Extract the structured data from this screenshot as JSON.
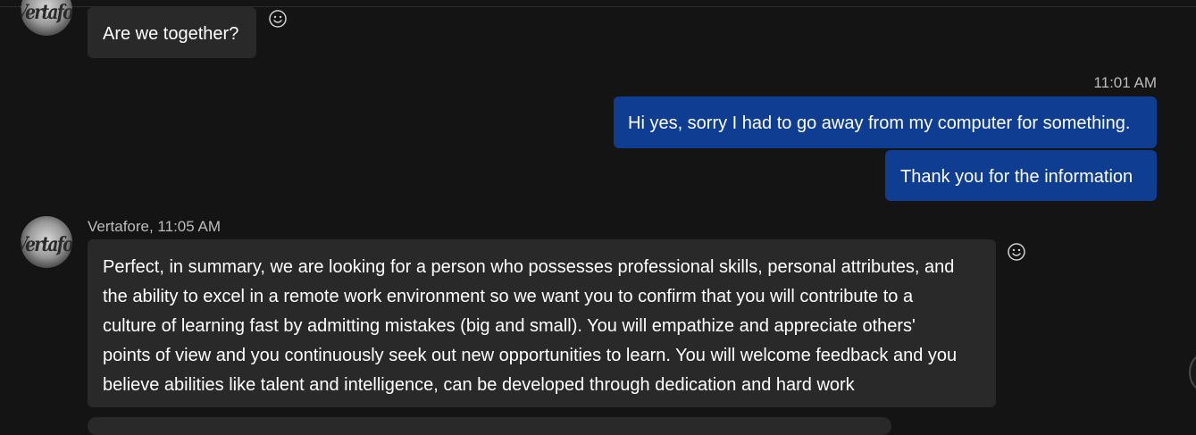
{
  "messages": [
    {
      "direction": "incoming",
      "avatar_logo": "Vertafor",
      "text": "Are we together?"
    },
    {
      "direction": "outgoing",
      "timestamp": "11:01 AM",
      "texts": [
        "Hi yes, sorry I had to go away from my computer for something.",
        "Thank you for the information"
      ]
    },
    {
      "direction": "incoming",
      "sender_meta": "Vertafore, 11:05 AM",
      "avatar_logo": "Vertafor",
      "lines": [
        "Perfect, in summary, we are looking for a person who possesses professional skills, personal attributes, and",
        "the ability to excel in a remote work environment so we want you to confirm that you will contribute to a",
        "culture of learning fast by admitting mistakes (big and small). You will empathize and appreciate others'",
        "points of view and you continuously seek out new opportunities to learn. You will welcome feedback and you",
        "believe abilities like talent and intelligence, can be developed through dedication and hard work"
      ]
    }
  ],
  "icons": {
    "reaction": "smiley-icon"
  },
  "colors": {
    "background": "#141414",
    "incoming_bubble": "#292929",
    "outgoing_bubble": "#0f3d92",
    "meta_text": "#bcbcbc"
  }
}
